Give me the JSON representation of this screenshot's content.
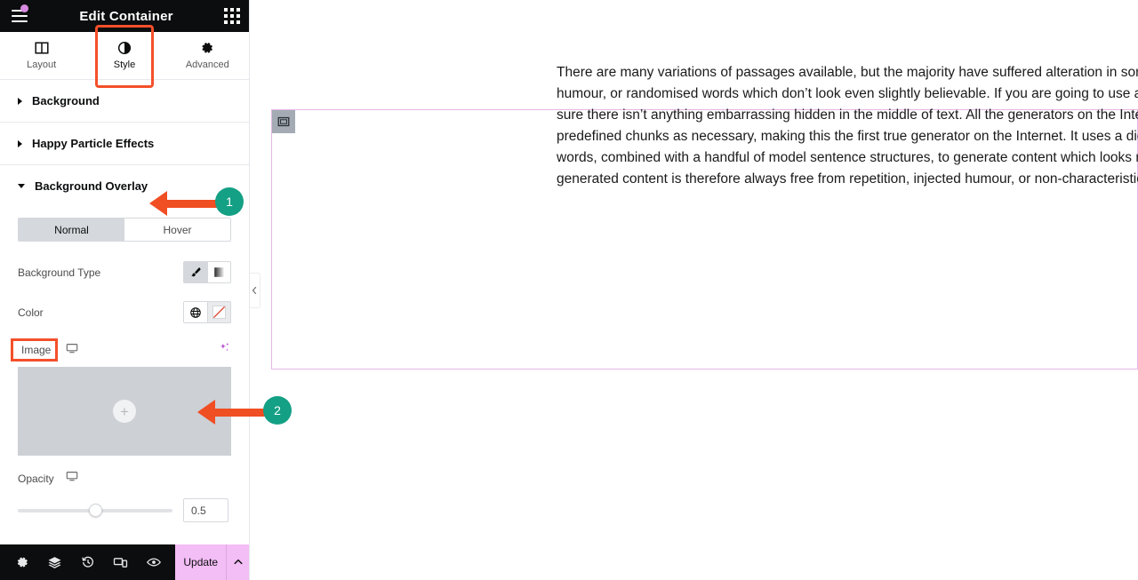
{
  "panel": {
    "header": {
      "title": "Edit Container",
      "menu_icon": "hamburger-menu-icon",
      "apps_icon": "apps-grid-icon",
      "notification_dot_color": "#d88ae0"
    },
    "tabs": [
      {
        "label": "Layout",
        "icon": "columns-icon",
        "active": false
      },
      {
        "label": "Style",
        "icon": "contrast-circle-icon",
        "active": true
      },
      {
        "label": "Advanced",
        "icon": "gear-icon",
        "active": false
      }
    ],
    "sections": [
      {
        "label": "Background",
        "expanded": false
      },
      {
        "label": "Happy Particle Effects",
        "expanded": false
      },
      {
        "label": "Background Overlay",
        "expanded": true
      }
    ],
    "overlay": {
      "state_tabs": [
        {
          "label": "Normal",
          "active": true
        },
        {
          "label": "Hover",
          "active": false
        }
      ],
      "background_type": {
        "label": "Background Type",
        "options": [
          {
            "icon": "brush-icon",
            "active": true
          },
          {
            "icon": "gradient-icon",
            "active": false
          }
        ]
      },
      "color": {
        "label": "Color",
        "options": [
          {
            "icon": "globe-icon",
            "active": false
          },
          {
            "icon": "no-color-swatch-icon",
            "active": false
          }
        ]
      },
      "image": {
        "label": "Image",
        "responsive_icon": "desktop-monitor-icon",
        "ai_icon": "ai-sparkle-icon",
        "placeholder_icon": "plus-circle-icon"
      },
      "opacity": {
        "label": "Opacity",
        "responsive_icon": "desktop-monitor-icon",
        "value": "0.5",
        "slider_percent": 50
      }
    },
    "footer": {
      "tools": [
        {
          "icon": "gear-icon",
          "name": "settings"
        },
        {
          "icon": "layers-icon",
          "name": "navigator"
        },
        {
          "icon": "history-icon",
          "name": "history"
        },
        {
          "icon": "responsive-icon",
          "name": "responsive-mode"
        },
        {
          "icon": "eye-icon",
          "name": "preview"
        }
      ],
      "update_label": "Update",
      "update_caret_icon": "chevron-up-icon",
      "update_color": "#f3bdf5"
    }
  },
  "canvas": {
    "collapse_icon": "chevron-left-icon",
    "container_handle_icon": "container-icon",
    "container_border_color": "#e6b7e8",
    "body_text": "There are many variations of passages available, but the majority have suffered alteration in some form, by injected humour, or randomised words which don’t look even slightly believable. If you are going to use a passage, you need to be sure there isn’t anything embarrassing hidden in the middle of text. All the generators on the Internet tend to repeat predefined chunks as necessary, making this the first true generator on the Internet. It uses a dictionary of over Latin words, combined with a handful of model sentence structures, to generate content which looks reasonable. The generated content is therefore always free from repetition, injected humour, or non-characteristic words etc."
  },
  "annotations": {
    "accent_arrow_color": "#f04e23",
    "badge_color": "#14a085",
    "highlight_color": "#f4502a",
    "items": [
      {
        "number": "1",
        "target": "Background Overlay"
      },
      {
        "number": "2",
        "target": "Image"
      }
    ]
  }
}
